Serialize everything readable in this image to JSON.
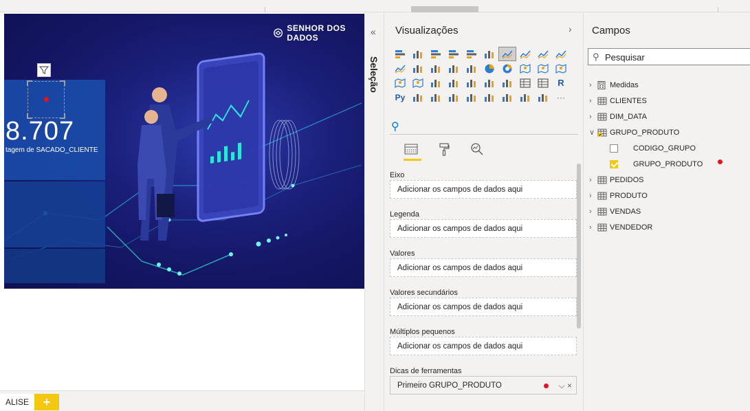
{
  "canvas": {
    "brand_name": "SENHOR DOS DADOS",
    "card": {
      "value": "8.707",
      "label": "tagem de SACADO_CLIENTE"
    }
  },
  "page_tabs": {
    "active_label": "ALISE",
    "add_label": "+"
  },
  "selection_pane": {
    "collapse_glyph": "«",
    "label": "Seleção"
  },
  "visualizations": {
    "title": "Visualizações",
    "expand_glyph": "›",
    "icon_rows": [
      [
        "stacked-bar-icon",
        "stacked-column-icon",
        "clustered-bar-icon",
        "clustered-column-icon",
        "100-bar-icon",
        "100-column-icon",
        "line-chart-icon",
        "area-chart-icon",
        "stacked-area-icon",
        "line-column-icon"
      ],
      [
        "line-clustered-icon",
        "ribbon-chart-icon",
        "waterfall-icon",
        "funnel-icon",
        "scatter-icon",
        "pie-chart-icon",
        "donut-chart-icon",
        "treemap-icon",
        "map-icon",
        "filled-map-icon"
      ],
      [
        "shape-map-icon",
        "azure-map-icon",
        "gauge-icon",
        "card-icon",
        "multi-row-card-icon",
        "kpi-icon",
        "slicer-icon",
        "table-icon",
        "matrix-icon",
        "r-visual-icon"
      ],
      [
        "python-visual-icon",
        "key-influencers-icon",
        "decomposition-tree-icon",
        "qa-icon",
        "smart-narrative-icon",
        "paginated-report-icon",
        "power-apps-icon",
        "power-automate-icon",
        "more-visuals-icon",
        "ellipsis-icon"
      ]
    ],
    "r_label": "R",
    "py_label": "Py",
    "ellipsis_label": "···",
    "wells": [
      {
        "label": "Eixo",
        "placeholder": "Adicionar os campos de dados aqui"
      },
      {
        "label": "Legenda",
        "placeholder": "Adicionar os campos de dados aqui"
      },
      {
        "label": "Valores",
        "placeholder": "Adicionar os campos de dados aqui"
      },
      {
        "label": "Valores secundários",
        "placeholder": "Adicionar os campos de dados aqui"
      },
      {
        "label": "Múltiplos pequenos",
        "placeholder": "Adicionar os campos de dados aqui"
      },
      {
        "label": "Dicas de ferramentas",
        "value": "Primeiro GRUPO_PRODUTO",
        "controls": "⌵ ×"
      }
    ]
  },
  "fields": {
    "title": "Campos",
    "search_placeholder": "Pesquisar",
    "tables": [
      {
        "name": "Medidas",
        "icon": "calculator-icon",
        "expanded": false
      },
      {
        "name": "CLIENTES",
        "icon": "table-icon",
        "expanded": false
      },
      {
        "name": "DIM_DATA",
        "icon": "table-icon",
        "expanded": false
      },
      {
        "name": "GRUPO_PRODUTO",
        "icon": "table-checked-icon",
        "expanded": true,
        "columns": [
          {
            "name": "CODIGO_GRUPO",
            "checked": false
          },
          {
            "name": "GRUPO_PRODUTO",
            "checked": true
          }
        ]
      },
      {
        "name": "PEDIDOS",
        "icon": "table-icon",
        "expanded": false
      },
      {
        "name": "PRODUTO",
        "icon": "table-icon",
        "expanded": false
      },
      {
        "name": "VENDAS",
        "icon": "table-icon",
        "expanded": false
      },
      {
        "name": "VENDEDOR",
        "icon": "table-icon",
        "expanded": false
      }
    ]
  },
  "colors": {
    "accent_yellow": "#f2c811",
    "marker_red": "#e81123",
    "canvas_navy": "#141663",
    "card_blue": "#1a4ba8"
  }
}
